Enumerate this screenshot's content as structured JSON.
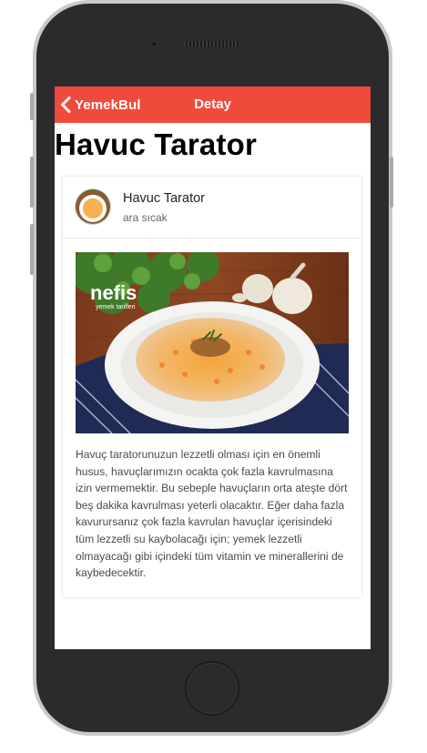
{
  "navbar": {
    "back_label": "YemekBul",
    "title": "Detay",
    "accent_color": "#f04a3c"
  },
  "page": {
    "title": "Havuc Tarator"
  },
  "card": {
    "title": "Havuc Tarator",
    "subtitle": "ara sıcak",
    "image_watermark": "nefis yemek tarifleri",
    "description": "Havuç taratorunuzun lezzetli olması için en önemli husus, havuçlarımızın ocakta çok fazla kavrulmasına izin vermemektir. Bu sebeple havuçların orta ateşte dört beş dakika kavrulması yeterli olacaktır. Eğer daha fazla kavurursanız çok fazla kavrulan havuçlar içerisindeki tüm lezzetli su kaybolacağı için; yemek lezzetli olmayacağı gibi içindeki tüm vitamin ve minerallerini de kaybedecektir."
  },
  "icons": {
    "back": "chevron-left-icon"
  }
}
